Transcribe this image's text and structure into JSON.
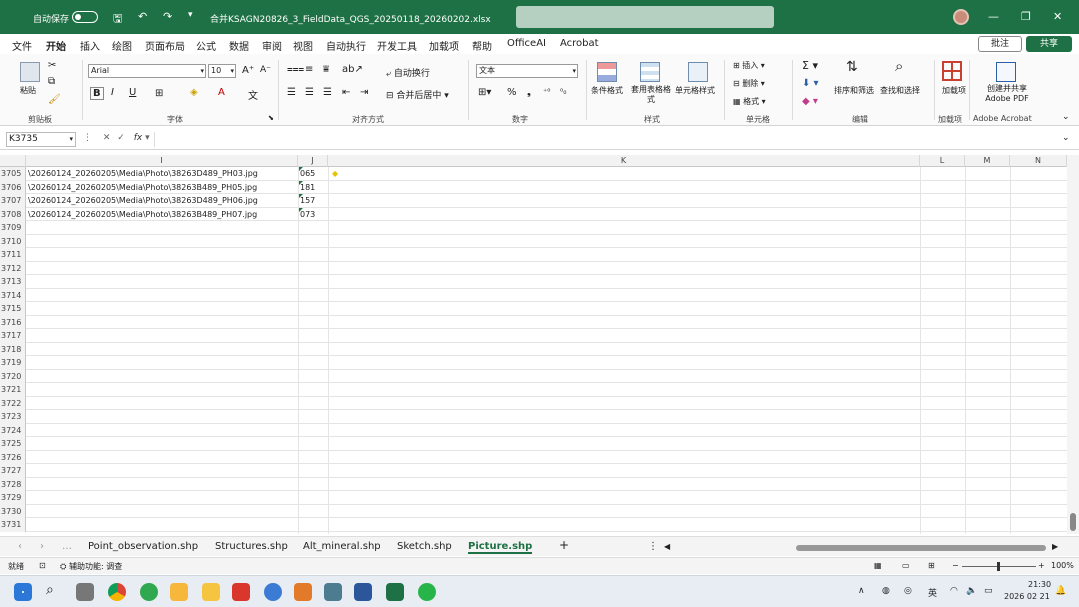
{
  "titlebar": {
    "autosave": "自动保存",
    "doc_title": "合并KSAGN20826_3_FieldData_QGS_20250118_20260202.xlsx",
    "colors": {
      "green": "#1e7145"
    }
  },
  "menu": [
    "文件",
    "开始",
    "插入",
    "绘图",
    "页面布局",
    "公式",
    "数据",
    "审阅",
    "视图",
    "自动执行",
    "开发工具",
    "加载项",
    "帮助",
    "OfficeAI",
    "Acrobat"
  ],
  "menu_active": "开始",
  "comment_label": "批注",
  "share_label": "共享",
  "ribbon": {
    "paste": "粘贴",
    "clipboard": "剪贴板",
    "font_name": "Arial",
    "font_size": "10",
    "font": "字体",
    "wrap": "自动换行",
    "merge": "合并后居中",
    "alignment": "对齐方式",
    "number_format": "文本",
    "number": "数字",
    "cond_format": "条件格式",
    "table_format": "套用表格格式",
    "cell_style": "单元格样式",
    "styles": "样式",
    "insert": "插入",
    "delete": "删除",
    "format": "格式",
    "cells": "单元格",
    "sort_filter": "排序和筛选",
    "find_select": "查找和选择",
    "editing": "编辑",
    "addin": "加载项",
    "addin_group": "加载项",
    "adobe_create": "创建并共享Adobe PDF",
    "adobe_group": "Adobe Acrobat"
  },
  "formula_bar": {
    "name_box": "K3735",
    "fx": "fx",
    "value": ""
  },
  "columns": {
    "I": "I",
    "J": "J",
    "K": "K",
    "L": "L",
    "M": "M",
    "N": "N"
  },
  "rows": [
    {
      "num": "3705",
      "path": "\\20260124_20260205\\Media\\Photo\\38263D489_PH03.jpg",
      "j": "065"
    },
    {
      "num": "3706",
      "path": "\\20260124_20260205\\Media\\Photo\\38263B489_PH05.jpg",
      "j": "181"
    },
    {
      "num": "3707",
      "path": "\\20260124_20260205\\Media\\Photo\\38263D489_PH06.jpg",
      "j": "157"
    },
    {
      "num": "3708",
      "path": "\\20260124_20260205\\Media\\Photo\\38263B489_PH07.jpg",
      "j": "073"
    },
    {
      "num": "3709",
      "path": "",
      "j": ""
    },
    {
      "num": "3710",
      "path": "",
      "j": ""
    },
    {
      "num": "3711",
      "path": "",
      "j": ""
    },
    {
      "num": "3712",
      "path": "",
      "j": ""
    },
    {
      "num": "3713",
      "path": "",
      "j": ""
    },
    {
      "num": "3714",
      "path": "",
      "j": ""
    },
    {
      "num": "3715",
      "path": "",
      "j": ""
    },
    {
      "num": "3716",
      "path": "",
      "j": ""
    },
    {
      "num": "3717",
      "path": "",
      "j": ""
    },
    {
      "num": "3718",
      "path": "",
      "j": ""
    },
    {
      "num": "3719",
      "path": "",
      "j": ""
    },
    {
      "num": "3720",
      "path": "",
      "j": ""
    },
    {
      "num": "3721",
      "path": "",
      "j": ""
    },
    {
      "num": "3722",
      "path": "",
      "j": ""
    },
    {
      "num": "3723",
      "path": "",
      "j": ""
    },
    {
      "num": "3724",
      "path": "",
      "j": ""
    },
    {
      "num": "3725",
      "path": "",
      "j": ""
    },
    {
      "num": "3726",
      "path": "",
      "j": ""
    },
    {
      "num": "3727",
      "path": "",
      "j": ""
    },
    {
      "num": "3728",
      "path": "",
      "j": ""
    },
    {
      "num": "3729",
      "path": "",
      "j": ""
    },
    {
      "num": "3730",
      "path": "",
      "j": ""
    },
    {
      "num": "3731",
      "path": "",
      "j": ""
    }
  ],
  "sheets": [
    "Point_observation.shp",
    "Structures.shp",
    "Alt_mineral.shp",
    "Sketch.shp",
    "Picture.shp"
  ],
  "active_sheet": "Picture.shp",
  "status": {
    "mode": "就绪",
    "accessibility": "辅助功能: 调查",
    "zoom": "100%"
  },
  "taskbar": {
    "ime": "英",
    "time": "21:30",
    "date": "2026 02 21"
  }
}
